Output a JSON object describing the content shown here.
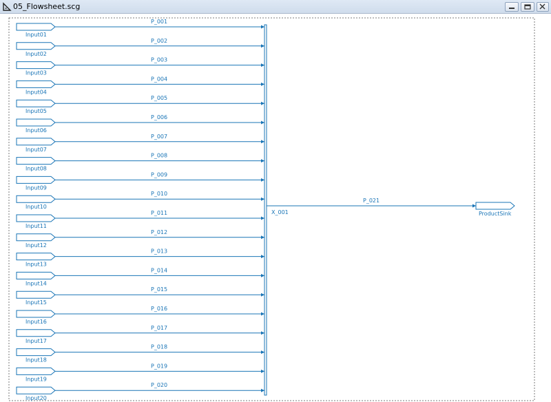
{
  "window": {
    "title": "05_Flowsheet.scg",
    "buttons": [
      {
        "name": "minimize",
        "icon": "minimize-icon"
      },
      {
        "name": "restore",
        "icon": "restore-icon"
      },
      {
        "name": "close",
        "icon": "close-icon"
      }
    ]
  },
  "colors": {
    "stream": "#1874b6",
    "boundary": "#7a7a7a",
    "background": "#ffffff"
  },
  "flowsheet": {
    "inputs": [
      {
        "label": "Input01",
        "stream": "P_001"
      },
      {
        "label": "Input02",
        "stream": "P_002"
      },
      {
        "label": "Input03",
        "stream": "P_003"
      },
      {
        "label": "Input04",
        "stream": "P_004"
      },
      {
        "label": "Input05",
        "stream": "P_005"
      },
      {
        "label": "Input06",
        "stream": "P_006"
      },
      {
        "label": "Input07",
        "stream": "P_007"
      },
      {
        "label": "Input08",
        "stream": "P_008"
      },
      {
        "label": "Input09",
        "stream": "P_009"
      },
      {
        "label": "Input10",
        "stream": "P_010"
      },
      {
        "label": "Input11",
        "stream": "P_011"
      },
      {
        "label": "Input12",
        "stream": "P_012"
      },
      {
        "label": "Input13",
        "stream": "P_013"
      },
      {
        "label": "Input14",
        "stream": "P_014"
      },
      {
        "label": "Input15",
        "stream": "P_015"
      },
      {
        "label": "Input16",
        "stream": "P_016"
      },
      {
        "label": "Input17",
        "stream": "P_017"
      },
      {
        "label": "Input18",
        "stream": "P_018"
      },
      {
        "label": "Input19",
        "stream": "P_019"
      },
      {
        "label": "Input20",
        "stream": "P_020"
      }
    ],
    "mixer": {
      "label": "X_001"
    },
    "outlet": {
      "stream": "P_021"
    },
    "sink": {
      "label": "ProductSink"
    }
  }
}
